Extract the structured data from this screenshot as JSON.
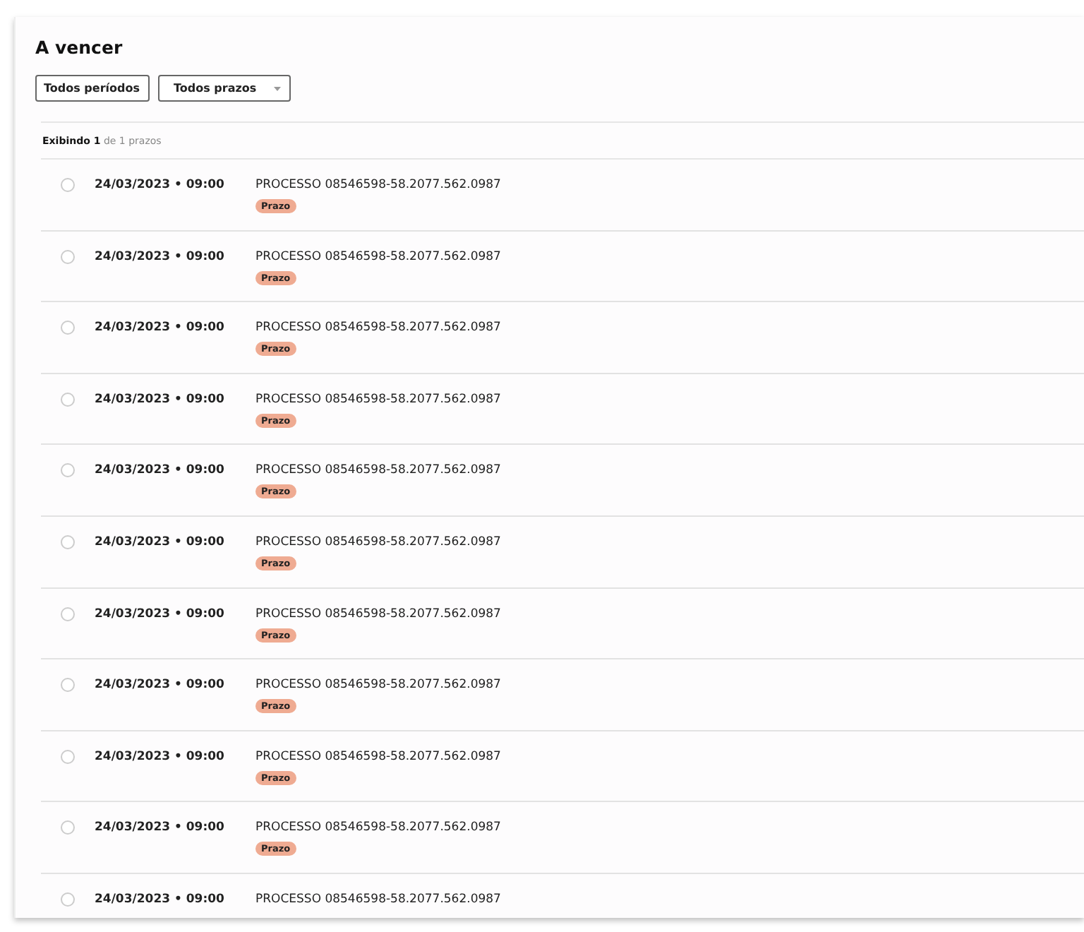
{
  "title": "A vencer",
  "filters": [
    {
      "label": "Todos períodos",
      "dropdown": false
    },
    {
      "label": "Todos prazos",
      "dropdown": true
    }
  ],
  "summary": "**Exibindo 1** de 1 prazos",
  "rows": [
    {
      "selected": false,
      "date": "24/03/2023 • 09:00",
      "process": "PROCESSO 08546598-58.2077.562.0987",
      "tag": "Prazo"
    },
    {
      "selected": false,
      "date": "24/03/2023 • 09:00",
      "process": "PROCESSO 08546598-58.2077.562.0987",
      "tag": "Prazo"
    },
    {
      "selected": false,
      "date": "24/03/2023 • 09:00",
      "process": "PROCESSO 08546598-58.2077.562.0987",
      "tag": "Prazo"
    },
    {
      "selected": false,
      "date": "24/03/2023 • 09:00",
      "process": "PROCESSO 08546598-58.2077.562.0987",
      "tag": "Prazo"
    },
    {
      "selected": false,
      "date": "24/03/2023 • 09:00",
      "process": "PROCESSO 08546598-58.2077.562.0987",
      "tag": "Prazo"
    },
    {
      "selected": false,
      "date": "24/03/2023 • 09:00",
      "process": "PROCESSO 08546598-58.2077.562.0987",
      "tag": "Prazo"
    },
    {
      "selected": false,
      "date": "24/03/2023 • 09:00",
      "process": "PROCESSO 08546598-58.2077.562.0987",
      "tag": "Prazo"
    },
    {
      "selected": false,
      "date": "24/03/2023 • 09:00",
      "process": "PROCESSO 08546598-58.2077.562.0987",
      "tag": "Prazo"
    },
    {
      "selected": false,
      "date": "24/03/2023 • 09:00",
      "process": "PROCESSO 08546598-58.2077.562.0987",
      "tag": "Prazo"
    },
    {
      "selected": false,
      "date": "24/03/2023 • 09:00",
      "process": "PROCESSO 08546598-58.2077.562.0987",
      "tag": "Prazo"
    },
    {
      "selected": false,
      "date": "24/03/2023 • 09:00",
      "process": "PROCESSO 08546598-58.2077.562.0987"
    }
  ]
}
